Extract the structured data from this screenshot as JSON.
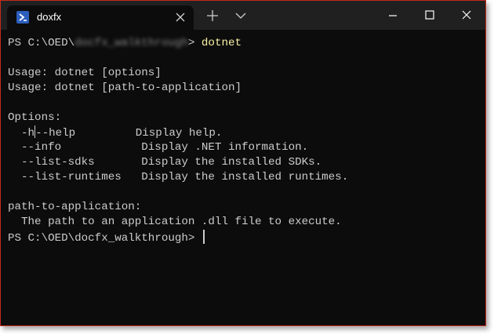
{
  "window": {
    "tab_title": "doxfx",
    "tab_icon": "powershell-icon",
    "buttons": [
      "new-tab-icon",
      "chevron-down-icon",
      "minimize-icon",
      "maximize-icon",
      "close-icon"
    ]
  },
  "colors": {
    "background": "#0c0c0c",
    "titlebar": "#202020",
    "text": "#cccccc",
    "command": "#f9f1a5",
    "border": "#c42b1c"
  },
  "terminal": {
    "prompt_prefix": "PS C:\\OED\\",
    "prompt_blurred": "docfx_walkthrough",
    "prompt_suffix": "> ",
    "command": "dotnet",
    "usage_1": "Usage: dotnet [options]",
    "usage_2": "Usage: dotnet [path-to-application]",
    "options_header": "Options:",
    "opt_help_a": "  -h",
    "opt_help_b": "--help         Display help.",
    "opt_info": "  --info            Display .NET information.",
    "opt_sdks": "  --list-sdks       Display the installed SDKs.",
    "opt_runtimes": "  --list-runtimes   Display the installed runtimes.",
    "path_header": "path-to-application:",
    "path_desc": "  The path to an application .dll file to execute.",
    "prompt_final": "PS C:\\OED\\docfx_walkthrough> "
  }
}
